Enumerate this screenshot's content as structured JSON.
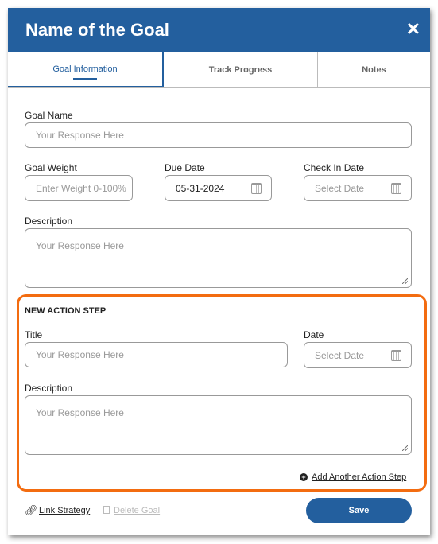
{
  "colors": {
    "accent": "#235f9e",
    "highlight": "#f36c10"
  },
  "header": {
    "title": "Name of the Goal",
    "close": "✕"
  },
  "tabs": [
    {
      "label": "Goal Information",
      "active": true
    },
    {
      "label": "Track Progress"
    },
    {
      "label": "Notes"
    }
  ],
  "form": {
    "goal_name": {
      "label": "Goal Name",
      "placeholder": "Your Response Here"
    },
    "goal_weight": {
      "label": "Goal Weight",
      "placeholder": "Enter Weight 0-100%"
    },
    "due_date": {
      "label": "Due Date",
      "value": "05-31-2024"
    },
    "check_in_date": {
      "label": "Check In Date",
      "placeholder": "Select Date"
    },
    "description": {
      "label": "Description",
      "placeholder": "Your Response Here"
    }
  },
  "action_step": {
    "heading": "NEW ACTION STEP",
    "title": {
      "label": "Title",
      "placeholder": "Your Response Here"
    },
    "date": {
      "label": "Date",
      "placeholder": "Select Date"
    },
    "description": {
      "label": "Description",
      "placeholder": "Your Response Here"
    },
    "add_another": "Add Another Action Step"
  },
  "footer": {
    "link_strategy": "Link Strategy",
    "delete_goal": "Delete Goal",
    "save": "Save"
  }
}
